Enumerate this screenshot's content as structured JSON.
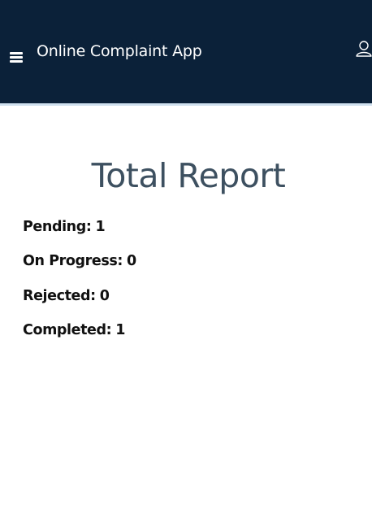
{
  "header": {
    "app_title": "Online Complaint App",
    "menu_icon": "hamburger-menu-icon",
    "user_icon": "user-icon",
    "background_color": "#0b2139"
  },
  "report": {
    "heading": "Total Report",
    "stats": [
      {
        "label": "Pending:",
        "value": "1"
      },
      {
        "label": "On Progress:",
        "value": "0"
      },
      {
        "label": "Rejected:",
        "value": "0"
      },
      {
        "label": "Completed:",
        "value": "1"
      }
    ]
  }
}
